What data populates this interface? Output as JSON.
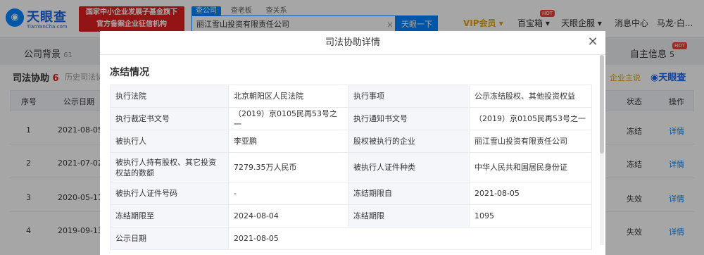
{
  "header": {
    "logo_text": "天眼查",
    "logo_sub": "TianYanCha.com",
    "banner_line1": "国家中小企业发展子基金旗下",
    "banner_line2": "官方备案企业征信机构",
    "search_tabs": [
      "查公司",
      "查老板",
      "查关系"
    ],
    "search_value": "丽江雪山投资有限责任公司",
    "search_button": "天眼一下",
    "nav": {
      "vip": "VIP会员",
      "baixiang": "百宝箱",
      "qiyefu": "天眼企服",
      "message": "消息中心",
      "user": "马龙·白...",
      "hot1": "HOT",
      "hot2": "HOT"
    }
  },
  "background_page": {
    "tab_left": "公司背景",
    "tab_left_count": "61",
    "tab_right": "自主信息",
    "tab_right_count": "5",
    "tab_right_hot": "HOT",
    "section_title": "司法协助",
    "section_count": "6",
    "section_sub": "历史司法协",
    "qiye_zhu": "企业主说",
    "logo2": "天眼查",
    "columns": {
      "index": "序号",
      "date": "公示日期",
      "status": "状态",
      "action": "操作"
    },
    "rows": [
      {
        "index": "1",
        "date": "2021-08-05",
        "status": "冻结",
        "action": "详情"
      },
      {
        "index": "2",
        "date": "2021-07-02",
        "status": "冻结",
        "action": "详情"
      },
      {
        "index": "3",
        "date": "2020-05-11",
        "status": "失效",
        "action": "详情"
      },
      {
        "index": "4",
        "date": "2019-09-13",
        "status": "失效",
        "action": "详情"
      }
    ]
  },
  "modal": {
    "title": "司法协助详情",
    "subtitle": "冻结情况",
    "fields": {
      "court_label": "执行法院",
      "court_value": "北京朝阳区人民法院",
      "matter_label": "执行事项",
      "matter_value": "公示冻结股权、其他投资权益",
      "ruling_label": "执行裁定书文号",
      "ruling_value": "（2019）京0105民再53号之一",
      "notice_label": "执行通知书文号",
      "notice_value": "（2019）京0105民再53号之一",
      "person_label": "被执行人",
      "person_value": "李亚鹏",
      "company_label": "股权被执行的企业",
      "company_value": "丽江雪山投资有限责任公司",
      "amount_label": "被执行人持有股权、其它投资权益的数额",
      "amount_value": "7279.35万人民币",
      "idtype_label": "被执行人证件种类",
      "idtype_value": "中华人民共和国居民身份证",
      "idno_label": "被执行人证件号码",
      "idno_value": "-",
      "from_label": "冻结期限自",
      "from_value": "2021-08-05",
      "to_label": "冻结期限至",
      "to_value": "2024-08-04",
      "period_label": "冻结期限",
      "period_value": "1095",
      "pubdate_label": "公示日期",
      "pubdate_value": "2021-08-05"
    }
  }
}
